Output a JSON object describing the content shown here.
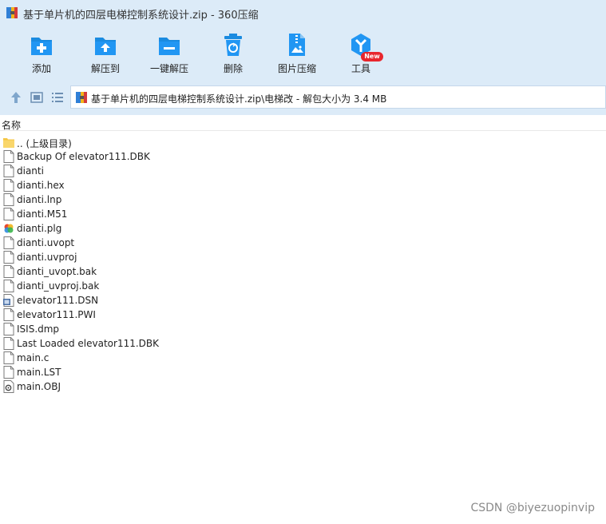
{
  "window": {
    "title": "基于单片机的四层电梯控制系统设计.zip - 360压缩"
  },
  "toolbar": {
    "items": [
      {
        "label": "添加",
        "icon": "add-icon"
      },
      {
        "label": "解压到",
        "icon": "extract-to-icon"
      },
      {
        "label": "一键解压",
        "icon": "one-click-extract-icon"
      },
      {
        "label": "删除",
        "icon": "delete-icon"
      },
      {
        "label": "图片压缩",
        "icon": "image-compress-icon"
      },
      {
        "label": "工具",
        "icon": "tools-icon"
      }
    ],
    "new_badge": "New"
  },
  "nav": {
    "path": "基于单片机的四层电梯控制系统设计.zip\\电梯改 - 解包大小为 3.4 MB"
  },
  "list": {
    "header_name": "名称",
    "files": [
      {
        "name": ".. (上级目录)",
        "icon": "folder-icon"
      },
      {
        "name": "Backup Of elevator111.DBK",
        "icon": "file-icon"
      },
      {
        "name": "dianti",
        "icon": "file-icon"
      },
      {
        "name": "dianti.hex",
        "icon": "file-icon"
      },
      {
        "name": "dianti.lnp",
        "icon": "file-icon"
      },
      {
        "name": "dianti.M51",
        "icon": "file-icon"
      },
      {
        "name": "dianti.plg",
        "icon": "colorful-file-icon"
      },
      {
        "name": "dianti.uvopt",
        "icon": "file-icon"
      },
      {
        "name": "dianti.uvproj",
        "icon": "file-icon"
      },
      {
        "name": "dianti_uvopt.bak",
        "icon": "file-icon"
      },
      {
        "name": "dianti_uvproj.bak",
        "icon": "file-icon"
      },
      {
        "name": "elevator111.DSN",
        "icon": "dsn-file-icon"
      },
      {
        "name": "elevator111.PWI",
        "icon": "file-icon"
      },
      {
        "name": "ISIS.dmp",
        "icon": "file-icon"
      },
      {
        "name": "Last Loaded elevator111.DBK",
        "icon": "file-icon"
      },
      {
        "name": "main.c",
        "icon": "file-icon"
      },
      {
        "name": "main.LST",
        "icon": "file-icon"
      },
      {
        "name": "main.OBJ",
        "icon": "obj-file-icon"
      }
    ]
  },
  "watermark": "CSDN @biyezuopinvip",
  "colors": {
    "topbar_bg": "#dcebf8",
    "icon_blue": "#1a8be0",
    "badge_red": "#e8262d"
  }
}
